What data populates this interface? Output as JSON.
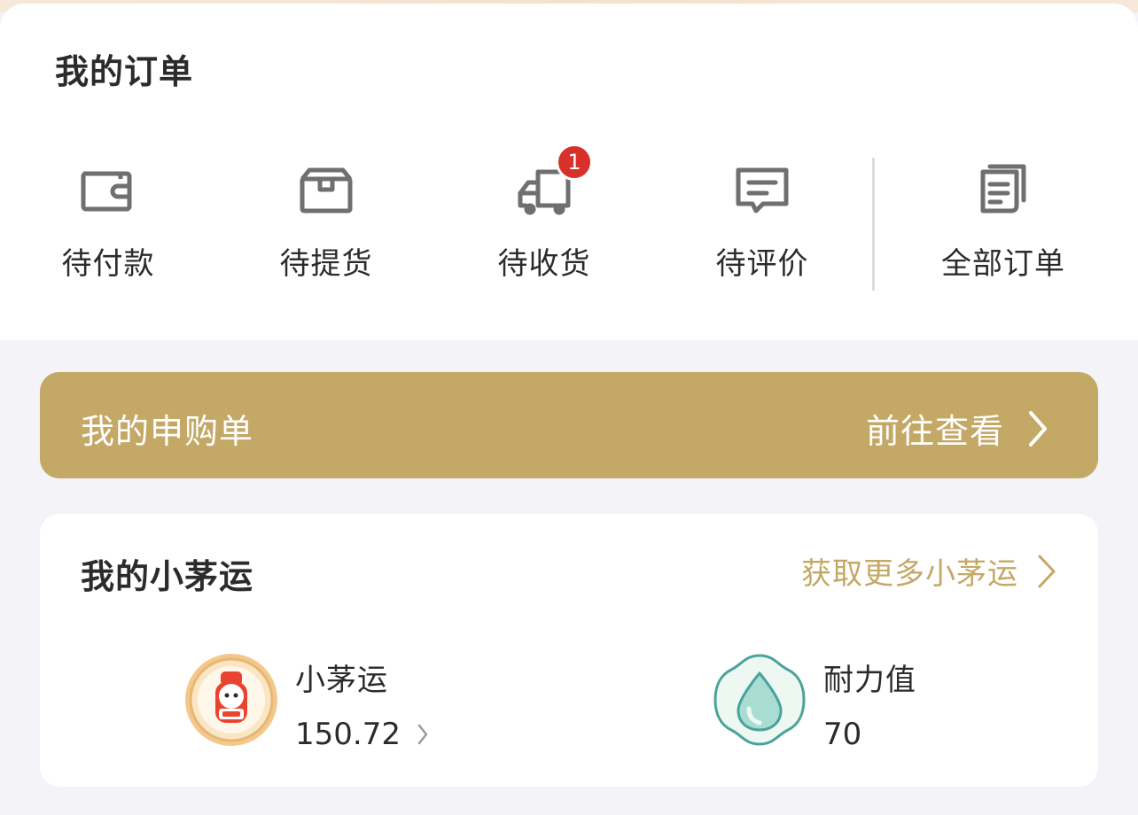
{
  "orders": {
    "title": "我的订单",
    "items": [
      {
        "label": "待付款",
        "icon": "wallet-icon"
      },
      {
        "label": "待提货",
        "icon": "box-icon"
      },
      {
        "label": "待收货",
        "icon": "truck-icon",
        "badge": "1"
      },
      {
        "label": "待评价",
        "icon": "comment-icon"
      },
      {
        "label": "全部订单",
        "icon": "document-icon"
      }
    ]
  },
  "purchase": {
    "title": "我的申购单",
    "link": "前往查看",
    "background": "#c4a866"
  },
  "luck": {
    "title": "我的小茅运",
    "more_link": "获取更多小茅运",
    "accent": "#c4a866",
    "stats": [
      {
        "label": "小茅运",
        "value": "150.72",
        "icon": "mascot-coin-icon"
      },
      {
        "label": "耐力值",
        "value": "70",
        "icon": "water-drop-icon"
      }
    ]
  },
  "colors": {
    "badge": "#d9302c",
    "page_background": "#f3f3f8",
    "icon_gray": "#6f6f6f"
  }
}
